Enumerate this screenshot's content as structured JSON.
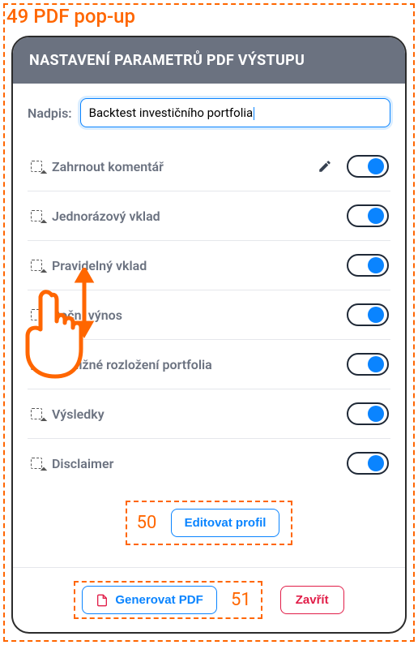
{
  "annotations": {
    "top": "49 PDF pop-up",
    "edit_profile": "50",
    "generate": "51"
  },
  "header": {
    "title": "NASTAVENÍ PARAMETRŮ PDF VÝSTUPU"
  },
  "title_field": {
    "label": "Nadpis:",
    "value": "Backtest investičního portfolia"
  },
  "options": [
    {
      "key": "comment",
      "label": "Zahrnout komentář",
      "editable": true,
      "enabled": true
    },
    {
      "key": "lump_sum",
      "label": "Jednorázový vklad",
      "editable": false,
      "enabled": true
    },
    {
      "key": "recurring",
      "label": "Pravidelný vklad",
      "editable": false,
      "enabled": true
    },
    {
      "key": "annual_ret",
      "label": "Roční výnos",
      "editable": false,
      "enabled": true
    },
    {
      "key": "allocation",
      "label": "Přibližné rozložení portfolia",
      "editable": false,
      "enabled": true
    },
    {
      "key": "results",
      "label": "Výsledky",
      "editable": false,
      "enabled": true
    },
    {
      "key": "disclaimer",
      "label": "Disclaimer",
      "editable": false,
      "enabled": true
    }
  ],
  "buttons": {
    "edit_profile": "Editovat profil",
    "generate_pdf": "Generovat PDF",
    "close": "Zavřít"
  }
}
